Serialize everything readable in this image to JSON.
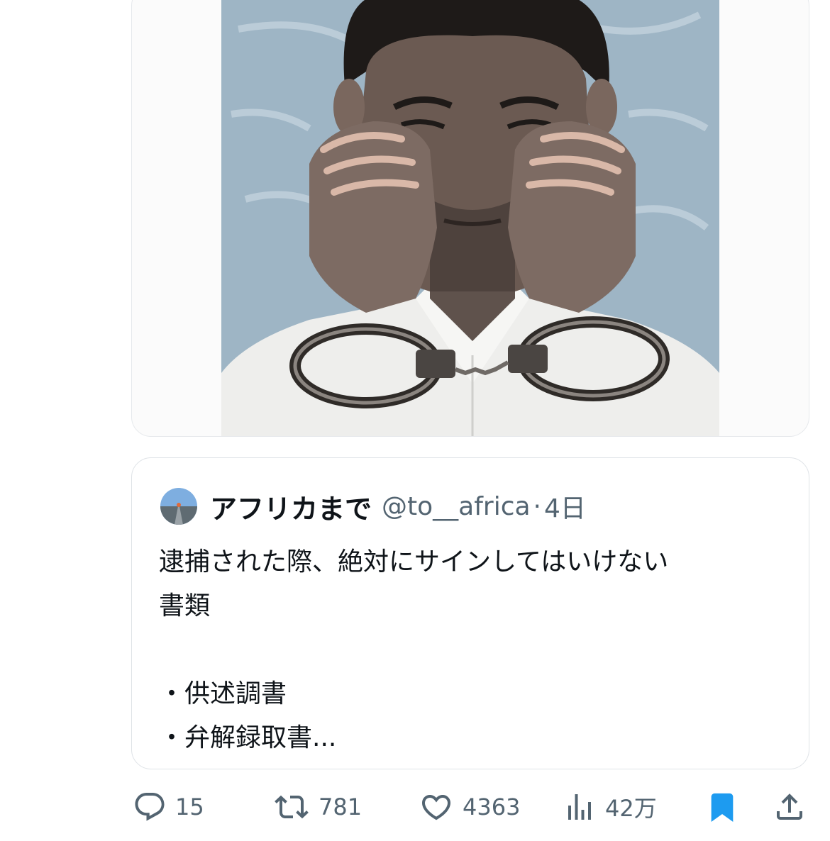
{
  "quoted_post": {
    "display_name": "アフリカまで",
    "handle": "@to__africa",
    "separator": "·",
    "time": "4日",
    "text": "逮捕された際、絶対にサインしてはいけない\n書類\n\n・供述調書\n・弁解録取書..."
  },
  "actions": {
    "replies": "15",
    "reposts": "781",
    "likes": "4363",
    "views": "42万"
  },
  "icons": {
    "reply": "speech-bubble-icon",
    "repost": "repost-arrows-icon",
    "like": "heart-icon",
    "views": "bar-chart-icon",
    "bookmark": "bookmark-filled-icon",
    "share": "share-upload-icon"
  },
  "colors": {
    "accent": "#1d9bf0",
    "muted_text": "#536471",
    "border": "#dfe3e7"
  }
}
